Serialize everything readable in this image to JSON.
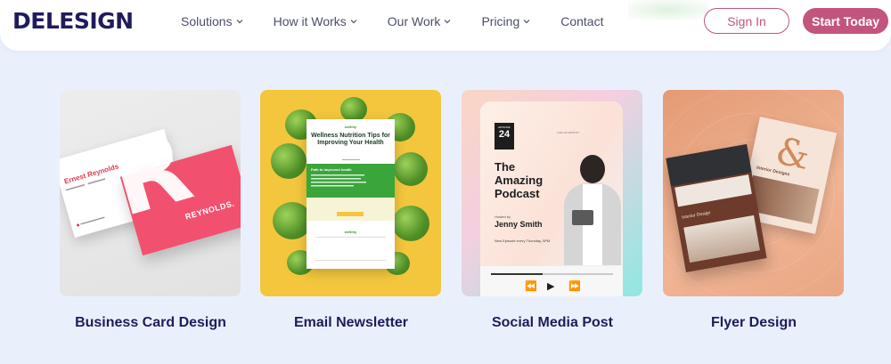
{
  "header": {
    "logo": "DELESIGN",
    "nav": [
      {
        "label": "Solutions",
        "has_dropdown": true
      },
      {
        "label": "How it Works",
        "has_dropdown": true
      },
      {
        "label": "Our Work",
        "has_dropdown": true
      },
      {
        "label": "Pricing",
        "has_dropdown": true
      },
      {
        "label": "Contact",
        "has_dropdown": false
      }
    ],
    "sign_in": "Sign In",
    "start_today": "Start Today"
  },
  "colors": {
    "brand_navy": "#1f1c5c",
    "accent_pink": "#c2557d",
    "page_bg": "#eaf0fb"
  },
  "cards": [
    {
      "title": "Business Card Design",
      "preview": {
        "name": "Ernest Reynolds",
        "brand": "REYNOLDS."
      }
    },
    {
      "title": "Email Newsletter",
      "preview": {
        "brand": "wellthy",
        "headline": "Wellness Nutrition Tips for Improving Your Health",
        "section": "Path to improved health"
      }
    },
    {
      "title": "Social Media Post",
      "preview": {
        "episode_label": "EPISODE",
        "episode_number": "24",
        "live": "LIVE ON SPOTIFY",
        "title": "The Amazing Podcast",
        "hosted_by": "Hosted by",
        "host": "Jenny Smith",
        "schedule": "New Episode every Thursday, 5PM",
        "progress": 0.42
      }
    },
    {
      "title": "Flyer Design",
      "preview": {
        "front_label": "Interior Design",
        "back_label": "Interior Designs"
      }
    }
  ]
}
